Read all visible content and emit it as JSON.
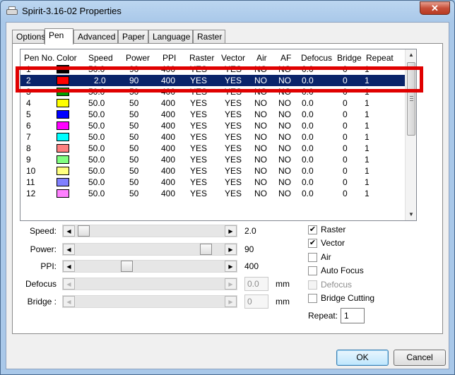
{
  "window": {
    "title": "Spirit-3.16-02 Properties",
    "close_glyph": "✕"
  },
  "tabs": [
    {
      "label": "Options"
    },
    {
      "label": "Pen"
    },
    {
      "label": "Advanced"
    },
    {
      "label": "Paper"
    },
    {
      "label": "Language"
    },
    {
      "label": "Raster"
    }
  ],
  "active_tab": "Pen",
  "grid": {
    "columns": [
      "Pen No.",
      "Color",
      "Speed",
      "Power",
      "PPI",
      "Raster",
      "Vector",
      "Air",
      "AF",
      "Defocus",
      "Bridge",
      "Repeat"
    ],
    "selected_row": 1,
    "rows": [
      {
        "pen": "1",
        "color": "#000000",
        "speed": "50.0",
        "power": "90",
        "ppi": "400",
        "raster": "YES",
        "vector": "YES",
        "air": "NO",
        "af": "NO",
        "defocus": "0.0",
        "bridge": "0",
        "repeat": "1"
      },
      {
        "pen": "2",
        "color": "#ff0000",
        "speed": "2.0",
        "power": "90",
        "ppi": "400",
        "raster": "YES",
        "vector": "YES",
        "air": "NO",
        "af": "NO",
        "defocus": "0.0",
        "bridge": "0",
        "repeat": "1"
      },
      {
        "pen": "3",
        "color": "#00a000",
        "speed": "50.0",
        "power": "50",
        "ppi": "400",
        "raster": "YES",
        "vector": "YES",
        "air": "NO",
        "af": "NO",
        "defocus": "0.0",
        "bridge": "0",
        "repeat": "1"
      },
      {
        "pen": "4",
        "color": "#ffff00",
        "speed": "50.0",
        "power": "50",
        "ppi": "400",
        "raster": "YES",
        "vector": "YES",
        "air": "NO",
        "af": "NO",
        "defocus": "0.0",
        "bridge": "0",
        "repeat": "1"
      },
      {
        "pen": "5",
        "color": "#0000ff",
        "speed": "50.0",
        "power": "50",
        "ppi": "400",
        "raster": "YES",
        "vector": "YES",
        "air": "NO",
        "af": "NO",
        "defocus": "0.0",
        "bridge": "0",
        "repeat": "1"
      },
      {
        "pen": "6",
        "color": "#ff00ff",
        "speed": "50.0",
        "power": "50",
        "ppi": "400",
        "raster": "YES",
        "vector": "YES",
        "air": "NO",
        "af": "NO",
        "defocus": "0.0",
        "bridge": "0",
        "repeat": "1"
      },
      {
        "pen": "7",
        "color": "#00ffff",
        "speed": "50.0",
        "power": "50",
        "ppi": "400",
        "raster": "YES",
        "vector": "YES",
        "air": "NO",
        "af": "NO",
        "defocus": "0.0",
        "bridge": "0",
        "repeat": "1"
      },
      {
        "pen": "8",
        "color": "#ff8080",
        "speed": "50.0",
        "power": "50",
        "ppi": "400",
        "raster": "YES",
        "vector": "YES",
        "air": "NO",
        "af": "NO",
        "defocus": "0.0",
        "bridge": "0",
        "repeat": "1"
      },
      {
        "pen": "9",
        "color": "#80ff80",
        "speed": "50.0",
        "power": "50",
        "ppi": "400",
        "raster": "YES",
        "vector": "YES",
        "air": "NO",
        "af": "NO",
        "defocus": "0.0",
        "bridge": "0",
        "repeat": "1"
      },
      {
        "pen": "10",
        "color": "#ffff80",
        "speed": "50.0",
        "power": "50",
        "ppi": "400",
        "raster": "YES",
        "vector": "YES",
        "air": "NO",
        "af": "NO",
        "defocus": "0.0",
        "bridge": "0",
        "repeat": "1"
      },
      {
        "pen": "11",
        "color": "#8080ff",
        "speed": "50.0",
        "power": "50",
        "ppi": "400",
        "raster": "YES",
        "vector": "YES",
        "air": "NO",
        "af": "NO",
        "defocus": "0.0",
        "bridge": "0",
        "repeat": "1"
      },
      {
        "pen": "12",
        "color": "#ff80ff",
        "speed": "50.0",
        "power": "50",
        "ppi": "400",
        "raster": "YES",
        "vector": "YES",
        "air": "NO",
        "af": "NO",
        "defocus": "0.0",
        "bridge": "0",
        "repeat": "1"
      }
    ]
  },
  "sliders": {
    "speed": {
      "label": "Speed:",
      "value": "2.0",
      "level": 0.02,
      "enabled": true
    },
    "power": {
      "label": "Power:",
      "value": "90",
      "level": 0.9,
      "enabled": true
    },
    "ppi": {
      "label": "PPI:",
      "value": "400",
      "level": 0.33,
      "enabled": true
    },
    "defocus": {
      "label": "Defocus",
      "value": "0.0",
      "unit": "mm",
      "enabled": false
    },
    "bridge": {
      "label": "Bridge :",
      "value": "0",
      "unit": "mm",
      "enabled": false
    }
  },
  "checkboxes": [
    {
      "label": "Raster",
      "checked": true,
      "enabled": true
    },
    {
      "label": "Vector",
      "checked": true,
      "enabled": true
    },
    {
      "label": "Air",
      "checked": false,
      "enabled": true
    },
    {
      "label": "Auto Focus",
      "checked": false,
      "enabled": true
    },
    {
      "label": "Defocus",
      "checked": false,
      "enabled": false
    },
    {
      "label": "Bridge Cutting",
      "checked": false,
      "enabled": true
    }
  ],
  "repeat": {
    "label": "Repeat:",
    "value": "1"
  },
  "buttons": {
    "ok": "OK",
    "cancel": "Cancel"
  },
  "annotation": {
    "color": "#e00000",
    "target_row": "2"
  }
}
